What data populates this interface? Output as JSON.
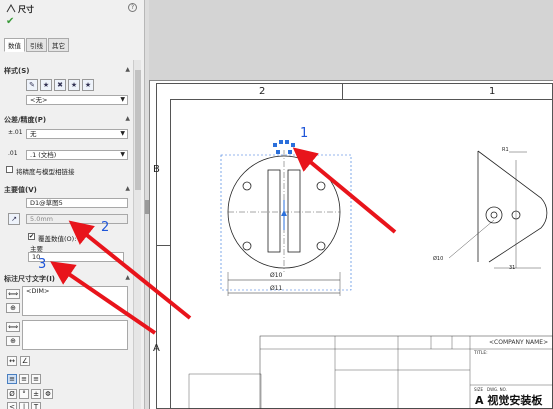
{
  "panel": {
    "title": "尺寸",
    "help_glyph": "?",
    "tabs": [
      "数值",
      "引线",
      "其它"
    ],
    "style": {
      "header": "样式(S)",
      "dropdown_value": "<无>"
    },
    "tolerance": {
      "header": "公差/精度(P)",
      "tolerance_value": "无",
      "precision_value": ".1 (文档)",
      "checkbox_label": "将精度与模型相链接"
    },
    "primary": {
      "header": "主要值(V)",
      "name_value": "D1@草图5",
      "value": "5.0mm",
      "override_label": "覆盖数值(O):",
      "sub_label": "主要",
      "override_value": "10"
    },
    "dimtext": {
      "header": "标注尺寸文字(I)",
      "placeholder": "<DIM>"
    },
    "symbols": [
      "Ø",
      "°",
      "±",
      "Φ"
    ]
  },
  "sheet": {
    "zones_top": [
      "2",
      "1"
    ],
    "zones_left": [
      "B",
      "A"
    ],
    "dims": {
      "d1": "Ø10",
      "d2": "Ø11",
      "d3": "Ø10",
      "d4": "31",
      "r1": "R1"
    },
    "title_block": {
      "company": "<COMPANY NAME>",
      "title_label": "TITLE:",
      "size_label": "SIZE",
      "dwg_label": "DWG. NO.",
      "watermark": "A 视觉安装板"
    }
  },
  "callouts": [
    "1",
    "2",
    "3"
  ],
  "colors": {
    "arrow": "#e8141b",
    "callout_text": "#1e55d8",
    "selection": "#2a6fdb"
  }
}
